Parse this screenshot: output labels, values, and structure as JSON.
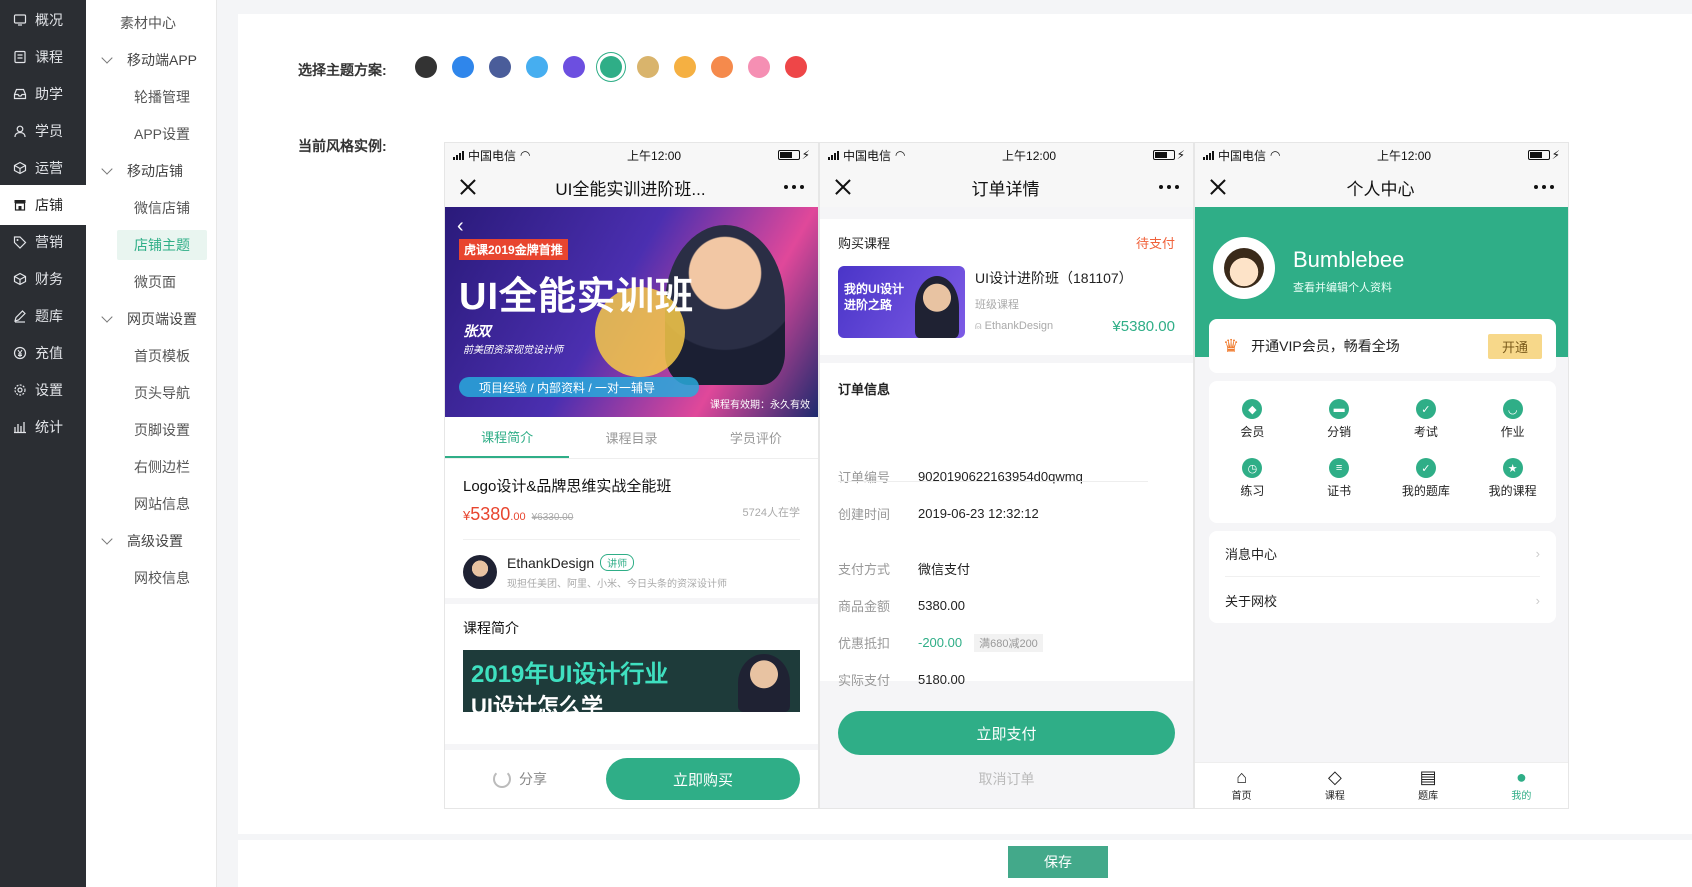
{
  "sidebar": {
    "items": [
      {
        "label": "概况",
        "icon": "monitor-icon"
      },
      {
        "label": "课程",
        "icon": "book-icon"
      },
      {
        "label": "助学",
        "icon": "inbox-icon"
      },
      {
        "label": "学员",
        "icon": "user-icon"
      },
      {
        "label": "运营",
        "icon": "box-icon"
      },
      {
        "label": "店铺",
        "icon": "store-icon"
      },
      {
        "label": "营销",
        "icon": "tag-icon"
      },
      {
        "label": "财务",
        "icon": "cube-icon"
      },
      {
        "label": "题库",
        "icon": "pen-icon"
      },
      {
        "label": "充值",
        "icon": "yen-icon"
      },
      {
        "label": "设置",
        "icon": "gear-icon"
      },
      {
        "label": "统计",
        "icon": "chart-icon"
      }
    ],
    "active": "店铺"
  },
  "subnav": {
    "items": [
      {
        "label": "素材中心",
        "type": "plain"
      },
      {
        "label": "移动端APP",
        "type": "group"
      },
      {
        "label": "轮播管理",
        "type": "leaf"
      },
      {
        "label": "APP设置",
        "type": "leaf"
      },
      {
        "label": "移动店铺",
        "type": "group"
      },
      {
        "label": "微信店铺",
        "type": "leaf"
      },
      {
        "label": "店铺主题",
        "type": "leaf"
      },
      {
        "label": "微页面",
        "type": "leaf"
      },
      {
        "label": "网页端设置",
        "type": "group"
      },
      {
        "label": "首页模板",
        "type": "leaf"
      },
      {
        "label": "页头导航",
        "type": "leaf"
      },
      {
        "label": "页脚设置",
        "type": "leaf"
      },
      {
        "label": "右侧边栏",
        "type": "leaf"
      },
      {
        "label": "网站信息",
        "type": "leaf"
      },
      {
        "label": "高级设置",
        "type": "group"
      },
      {
        "label": "网校信息",
        "type": "leaf"
      }
    ],
    "active": "店铺主题"
  },
  "theme": {
    "label": "选择主题方案:",
    "colors": [
      "#333333",
      "#2f86eb",
      "#4a5d9a",
      "#46aef0",
      "#6c4fe0",
      "#2fae87",
      "#d9b46c",
      "#f5b042",
      "#f58a4c",
      "#f58fb3",
      "#ee4648"
    ],
    "selected": "#2fae87"
  },
  "preview_label": "当前风格实例:",
  "status": {
    "carrier": "中国电信",
    "time": "上午12:00"
  },
  "phone1": {
    "title": "UI全能实训进阶班...",
    "banner": {
      "tag": "虎课2019金牌首推",
      "headline": "UI全能实训班",
      "name": "张双",
      "role": "前美团资深视觉设计师",
      "bar": "项目经验 / 内部资料 / 一对一辅导",
      "validity": "课程有效期：永久有效"
    },
    "tabs": [
      "课程简介",
      "课程目录",
      "学员评价"
    ],
    "course_title": "Logo设计&品牌思维实战全能班",
    "price_symbol": "¥",
    "price_int": "5380",
    "price_dec": ".00",
    "old_price": "¥6330.00",
    "learners": "5724人在学",
    "teacher": "EthankDesign",
    "teacher_badge": "讲师",
    "teacher_desc": "现担任美团、阿里、小米、今日头条的资深设计师",
    "section": "课程简介",
    "intro_img_line1": "2019年UI设计行业",
    "intro_img_line2": "UI设计怎么学",
    "share": "分享",
    "buy": "立即购买"
  },
  "phone2": {
    "title": "订单详情",
    "buy_label": "购买课程",
    "state": "待支付",
    "thumb_line1": "我的UI设计",
    "thumb_line2": "进阶之路",
    "course": "UI设计进阶班（181107）",
    "course_type": "班级课程",
    "teacher": "EthankDesign",
    "price": "¥5380.00",
    "info_title": "订单信息",
    "rows": [
      {
        "k": "订单编号",
        "v": "9020190622163954d0qwmq"
      },
      {
        "k": "创建时间",
        "v": "2019-06-23 12:32:12"
      },
      {
        "k": "支付方式",
        "v": "微信支付"
      },
      {
        "k": "商品金额",
        "v": "5380.00"
      },
      {
        "k": "优惠抵扣",
        "v": "-200.00",
        "tag": "满680减200"
      },
      {
        "k": "实际支付",
        "v": "5180.00"
      }
    ],
    "pay": "立即支付",
    "cancel": "取消订单"
  },
  "phone3": {
    "title": "个人中心",
    "username": "Bumblebee",
    "profile_hint": "查看并编辑个人资料",
    "vip_text": "开通VIP会员，畅看全场",
    "vip_btn": "开通",
    "grid": [
      {
        "label": "会员",
        "icon": "diamond-icon"
      },
      {
        "label": "分销",
        "icon": "ticket-icon"
      },
      {
        "label": "考试",
        "icon": "check-icon"
      },
      {
        "label": "作业",
        "icon": "smile-icon"
      },
      {
        "label": "练习",
        "icon": "clock-icon"
      },
      {
        "label": "证书",
        "icon": "certificate-icon"
      },
      {
        "label": "我的题库",
        "icon": "question-bank-icon"
      },
      {
        "label": "我的课程",
        "icon": "star-icon"
      }
    ],
    "menu": [
      "消息中心",
      "关于网校"
    ],
    "tabs": [
      {
        "label": "首页",
        "icon": "home-icon"
      },
      {
        "label": "课程",
        "icon": "diamond-icon"
      },
      {
        "label": "题库",
        "icon": "calendar-icon"
      },
      {
        "label": "我的",
        "icon": "profile-icon"
      }
    ],
    "active_tab": "我的"
  },
  "save": "保存"
}
